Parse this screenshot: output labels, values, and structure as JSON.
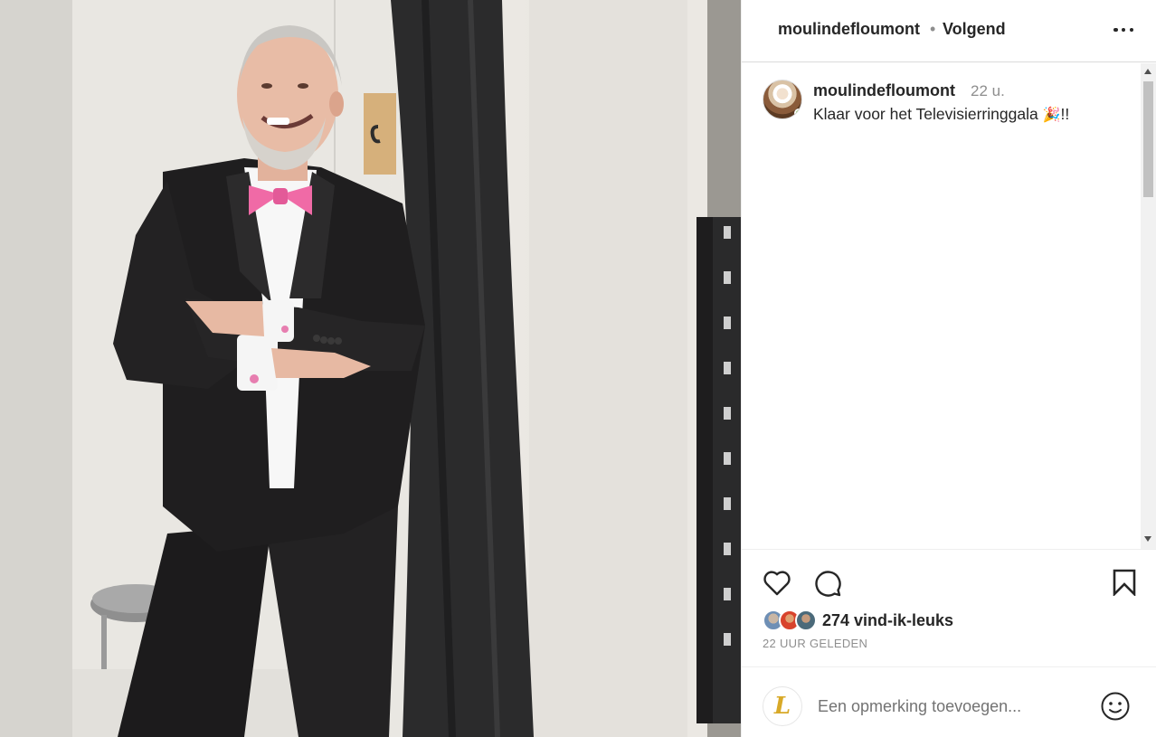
{
  "header": {
    "username": "moulindefloumont",
    "separator": "•",
    "follow_status": "Volgend",
    "more_icon": "more-horizontal-icon"
  },
  "post": {
    "author": "moulindefloumont",
    "time_ago": "22 u.",
    "caption": "Klaar voor het Televisierringgala",
    "caption_emoji": "🎉",
    "caption_suffix": "!!",
    "photo_alt": "Man in tuxedo with pink bow tie leaning against a curtain"
  },
  "actions": {
    "like_icon": "heart-icon",
    "comment_icon": "comment-icon",
    "save_icon": "bookmark-icon",
    "likes_text": "274 vind-ik-leuks",
    "posted_ago": "22 UUR GELEDEN"
  },
  "comment_box": {
    "placeholder": "Een opmerking toevoegen...",
    "avatar_letter": "L",
    "emoji_icon": "smiley-icon"
  },
  "colors": {
    "text": "#262626",
    "muted": "#8e8e8e",
    "bow_tie": "#f06aa6",
    "suit": "#1e1c1d",
    "curtain": "#2a2a2a"
  }
}
